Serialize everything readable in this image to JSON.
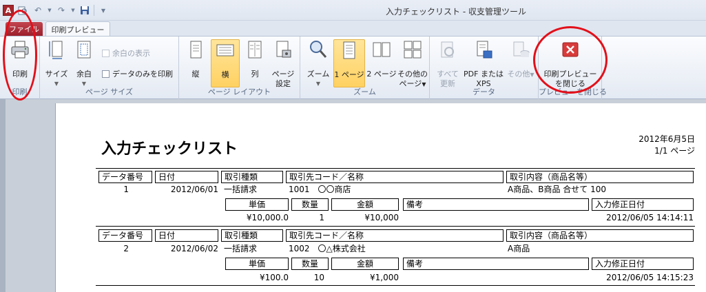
{
  "window": {
    "title": "入力チェックリスト - 収支管理ツール",
    "app_icon_letter": "A"
  },
  "tabs": [
    {
      "label": "ファイル"
    },
    {
      "label": "印刷プレビュー"
    }
  ],
  "ribbon": {
    "groups": {
      "print": {
        "label": "印刷",
        "buttons": {
          "print": "印刷"
        }
      },
      "page_size": {
        "label": "ページ サイズ",
        "buttons": {
          "size": "サイズ",
          "margins": "余白"
        },
        "checkboxes": {
          "show_margins": "余白の表示",
          "print_data_only": "データのみを印刷"
        }
      },
      "page_layout": {
        "label": "ページ レイアウト",
        "buttons": {
          "portrait": "縦",
          "landscape": "横",
          "columns": "列",
          "page_setup_1": "ページ",
          "page_setup_2": "設定"
        }
      },
      "zoom": {
        "label": "ズーム",
        "buttons": {
          "zoom": "ズーム",
          "one_page": "1 ページ",
          "two_pages": "2 ページ",
          "more_pages_1": "その他の",
          "more_pages_2": "ページ"
        }
      },
      "data": {
        "label": "データ",
        "buttons": {
          "refresh_1": "すべて",
          "refresh_2": "更新",
          "pdf_1": "PDF または",
          "pdf_2": "XPS",
          "more_1": "その他"
        }
      },
      "close_preview": {
        "label": "プレビューを閉じる",
        "buttons": {
          "close_1": "印刷プレビュー",
          "close_2": "を閉じる"
        }
      }
    }
  },
  "report": {
    "title": "入力チェックリスト",
    "date": "2012年6月5日",
    "page": "1/1 ページ",
    "headers": {
      "data_no": "データ番号",
      "date": "日付",
      "kind": "取引種類",
      "partner": "取引先コード／名称",
      "content": "取引内容（商品名等）",
      "unit_price": "単価",
      "quantity": "数量",
      "amount": "金額",
      "remarks": "備考",
      "modified": "入力修正日付"
    },
    "records": [
      {
        "no": "1",
        "date": "2012/06/01",
        "kind": "一括請求",
        "partner": "1001　〇〇商店",
        "content": "A商品、B商品 合せて 100",
        "unit_price": "¥10,000.0",
        "quantity": "1",
        "amount": "¥10,000",
        "remarks": "",
        "modified": "2012/06/05 14:14:11"
      },
      {
        "no": "2",
        "date": "2012/06/02",
        "kind": "一括請求",
        "partner": "1002　〇△株式会社",
        "content": "A商品",
        "unit_price": "¥100.0",
        "quantity": "10",
        "amount": "¥1,000",
        "remarks": "",
        "modified": "2012/06/05 14:15:23"
      }
    ]
  },
  "colors": {
    "annotation": "#e2101a",
    "file_tab": "#9c1f2b",
    "active_button": "#ffd162"
  }
}
